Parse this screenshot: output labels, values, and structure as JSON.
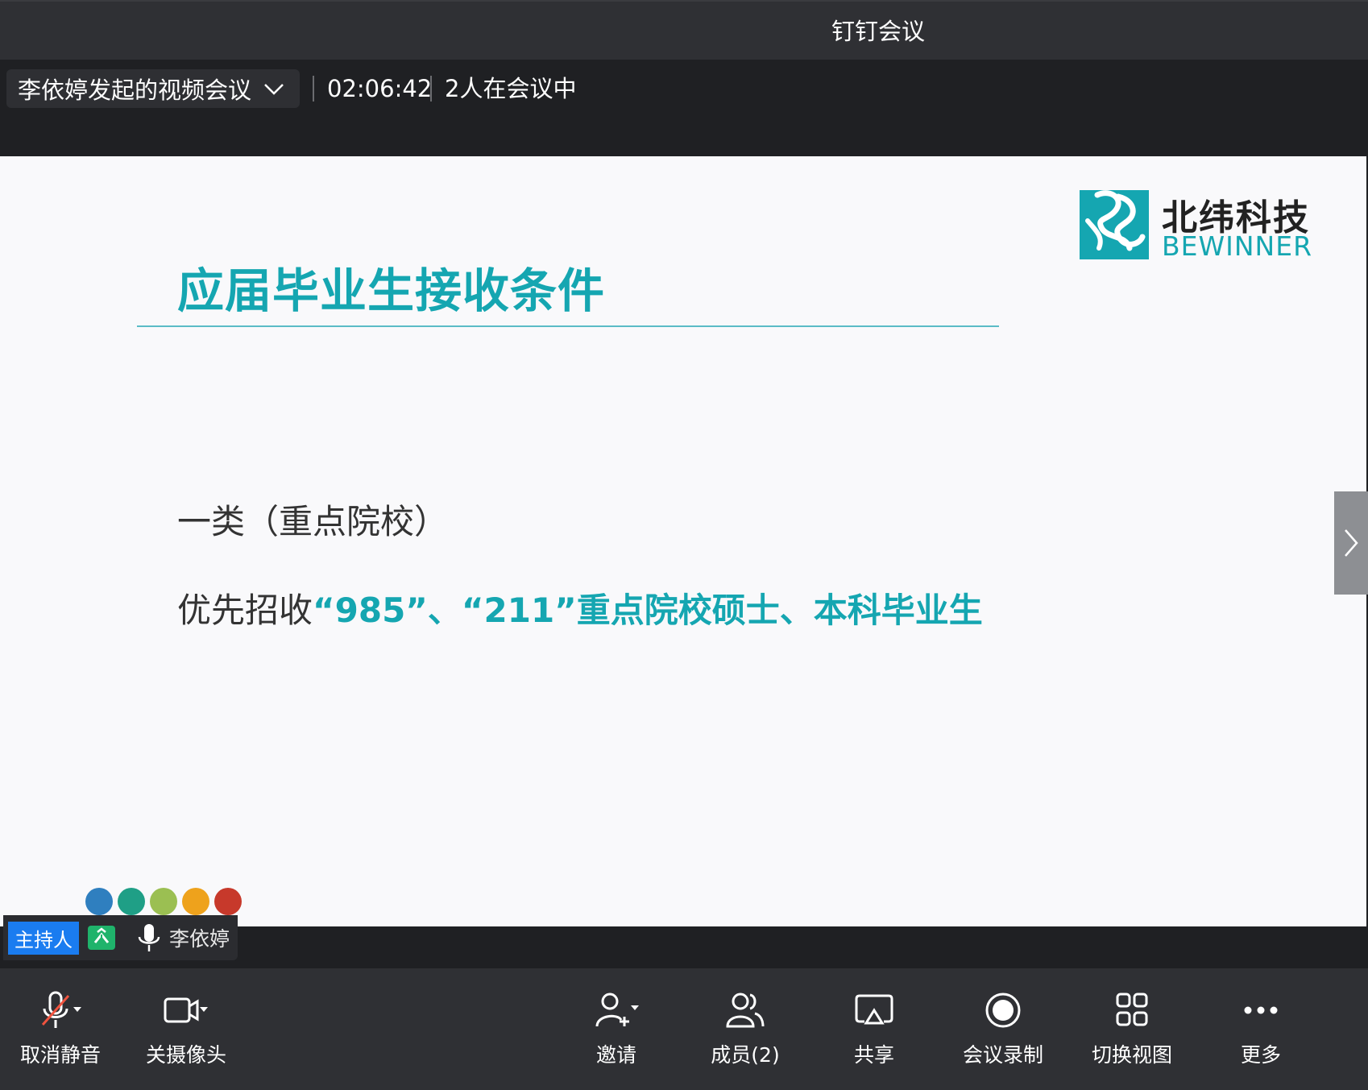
{
  "window": {
    "title": "钉钉会议"
  },
  "meeting": {
    "name": "李依婷发起的视频会议",
    "elapsed": "02:06:42",
    "participants": "2人在会议中"
  },
  "slide": {
    "heading": "应届毕业生接收条件",
    "category": "一类（重点院校）",
    "line_prefix": "优先招收",
    "line_highlight": "“985”、“211”重点院校硕士、本科毕业生",
    "logo_cn": "北纬科技",
    "logo_en": "BEWINNER",
    "brand_color": "#15a6b1",
    "dot_colors": [
      "#2f7fbf",
      "#1f9f86",
      "#9bbf52",
      "#eea21c",
      "#c7392b"
    ]
  },
  "speaker": {
    "role": "主持人",
    "name": "李依婷"
  },
  "toolbar": {
    "mute": "取消静音",
    "camera": "关摄像头",
    "invite": "邀请",
    "members": "成员(2)",
    "share": "共享",
    "record": "会议录制",
    "view": "切换视图",
    "more": "更多"
  }
}
